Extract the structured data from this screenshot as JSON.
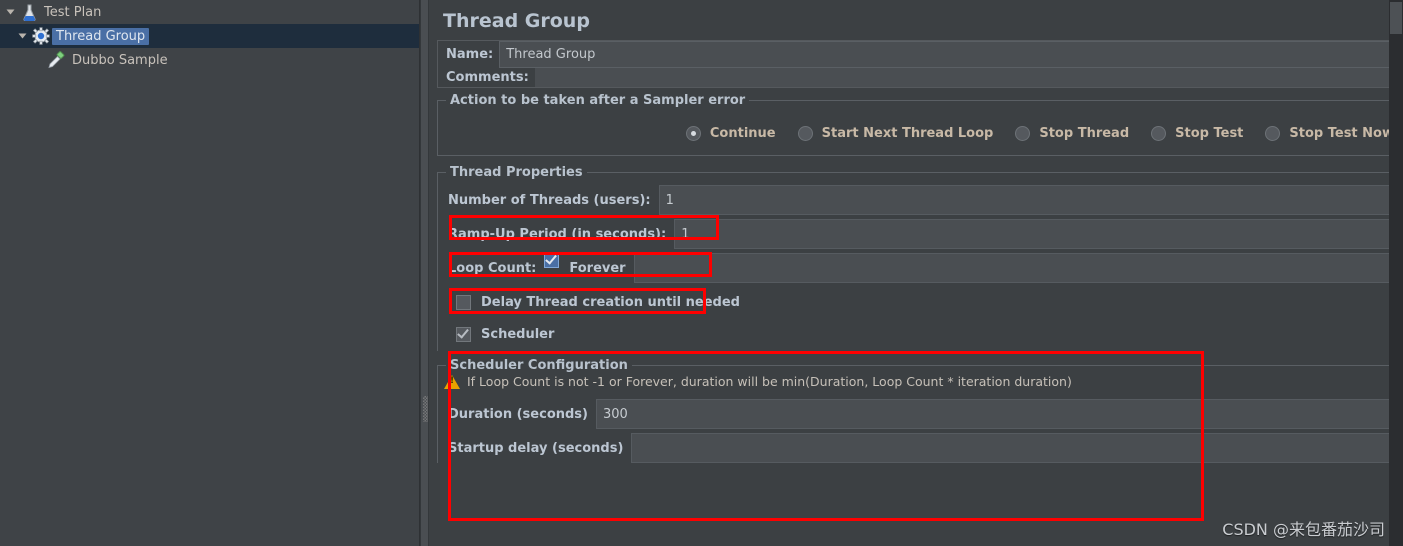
{
  "tree": {
    "items": [
      {
        "label": "Test Plan",
        "icon": "test-plan-icon",
        "expanded": true,
        "selected": false,
        "depth": 0
      },
      {
        "label": "Thread Group",
        "icon": "thread-group-icon",
        "expanded": true,
        "selected": true,
        "depth": 1
      },
      {
        "label": "Dubbo Sample",
        "icon": "dubbo-sampler-icon",
        "expanded": false,
        "selected": false,
        "depth": 2
      }
    ]
  },
  "panel": {
    "title": "Thread Group",
    "name_label": "Name:",
    "name_value": "Thread Group",
    "comments_label": "Comments:",
    "comments_value": ""
  },
  "sampler_error": {
    "group_title": "Action to be taken after a Sampler error",
    "options": [
      {
        "label": "Continue",
        "selected": true
      },
      {
        "label": "Start Next Thread Loop",
        "selected": false
      },
      {
        "label": "Stop Thread",
        "selected": false
      },
      {
        "label": "Stop Test",
        "selected": false
      },
      {
        "label": "Stop Test Now",
        "selected": false
      }
    ]
  },
  "thread_properties": {
    "group_title": "Thread Properties",
    "num_threads_label": "Number of Threads (users):",
    "num_threads_value": "1",
    "ramp_up_label": "Ramp-Up Period (in seconds):",
    "ramp_up_value": "1",
    "loop_count_label": "Loop Count:",
    "forever_label": "Forever",
    "forever_checked": true,
    "loop_count_value": "",
    "delay_thread_label": "Delay Thread creation until needed",
    "delay_thread_checked": false,
    "scheduler_label": "Scheduler",
    "scheduler_checked": true
  },
  "scheduler": {
    "group_title": "Scheduler Configuration",
    "warning_icon": "warning-triangle-icon",
    "warning_text": "If Loop Count is not -1 or Forever, duration will be min(Duration, Loop Count * iteration duration)",
    "duration_label": "Duration (seconds)",
    "duration_value": "300",
    "startup_delay_label": "Startup delay (seconds)",
    "startup_delay_value": ""
  },
  "watermark": {
    "text": "CSDN @来包番茄沙司"
  },
  "colors": {
    "annotation_red": "#fe0000",
    "panel_bg": "#3c4043",
    "field_bg": "#4a4e52",
    "label_fg": "#bcc6d2",
    "radio_label_fg": "#c8b9a6",
    "selection_blue": "#4a6fa5",
    "warning_amber": "#e8a200"
  }
}
